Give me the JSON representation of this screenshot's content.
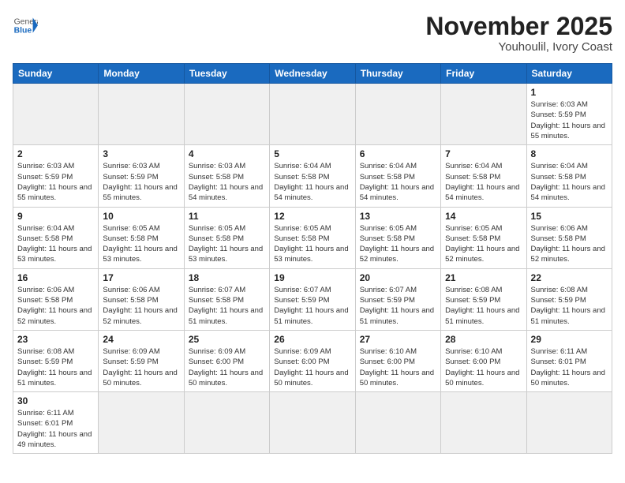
{
  "header": {
    "logo_general": "General",
    "logo_blue": "Blue",
    "month_title": "November 2025",
    "subtitle": "Youhoulil, Ivory Coast"
  },
  "days_of_week": [
    "Sunday",
    "Monday",
    "Tuesday",
    "Wednesday",
    "Thursday",
    "Friday",
    "Saturday"
  ],
  "weeks": [
    [
      {
        "day": null
      },
      {
        "day": null
      },
      {
        "day": null
      },
      {
        "day": null
      },
      {
        "day": null
      },
      {
        "day": null
      },
      {
        "day": "1",
        "sunrise": "6:03 AM",
        "sunset": "5:59 PM",
        "daylight": "11 hours and 55 minutes."
      }
    ],
    [
      {
        "day": "2",
        "sunrise": "6:03 AM",
        "sunset": "5:59 PM",
        "daylight": "11 hours and 55 minutes."
      },
      {
        "day": "3",
        "sunrise": "6:03 AM",
        "sunset": "5:59 PM",
        "daylight": "11 hours and 55 minutes."
      },
      {
        "day": "4",
        "sunrise": "6:03 AM",
        "sunset": "5:58 PM",
        "daylight": "11 hours and 54 minutes."
      },
      {
        "day": "5",
        "sunrise": "6:04 AM",
        "sunset": "5:58 PM",
        "daylight": "11 hours and 54 minutes."
      },
      {
        "day": "6",
        "sunrise": "6:04 AM",
        "sunset": "5:58 PM",
        "daylight": "11 hours and 54 minutes."
      },
      {
        "day": "7",
        "sunrise": "6:04 AM",
        "sunset": "5:58 PM",
        "daylight": "11 hours and 54 minutes."
      },
      {
        "day": "8",
        "sunrise": "6:04 AM",
        "sunset": "5:58 PM",
        "daylight": "11 hours and 54 minutes."
      }
    ],
    [
      {
        "day": "9",
        "sunrise": "6:04 AM",
        "sunset": "5:58 PM",
        "daylight": "11 hours and 53 minutes."
      },
      {
        "day": "10",
        "sunrise": "6:05 AM",
        "sunset": "5:58 PM",
        "daylight": "11 hours and 53 minutes."
      },
      {
        "day": "11",
        "sunrise": "6:05 AM",
        "sunset": "5:58 PM",
        "daylight": "11 hours and 53 minutes."
      },
      {
        "day": "12",
        "sunrise": "6:05 AM",
        "sunset": "5:58 PM",
        "daylight": "11 hours and 53 minutes."
      },
      {
        "day": "13",
        "sunrise": "6:05 AM",
        "sunset": "5:58 PM",
        "daylight": "11 hours and 52 minutes."
      },
      {
        "day": "14",
        "sunrise": "6:05 AM",
        "sunset": "5:58 PM",
        "daylight": "11 hours and 52 minutes."
      },
      {
        "day": "15",
        "sunrise": "6:06 AM",
        "sunset": "5:58 PM",
        "daylight": "11 hours and 52 minutes."
      }
    ],
    [
      {
        "day": "16",
        "sunrise": "6:06 AM",
        "sunset": "5:58 PM",
        "daylight": "11 hours and 52 minutes."
      },
      {
        "day": "17",
        "sunrise": "6:06 AM",
        "sunset": "5:58 PM",
        "daylight": "11 hours and 52 minutes."
      },
      {
        "day": "18",
        "sunrise": "6:07 AM",
        "sunset": "5:58 PM",
        "daylight": "11 hours and 51 minutes."
      },
      {
        "day": "19",
        "sunrise": "6:07 AM",
        "sunset": "5:59 PM",
        "daylight": "11 hours and 51 minutes."
      },
      {
        "day": "20",
        "sunrise": "6:07 AM",
        "sunset": "5:59 PM",
        "daylight": "11 hours and 51 minutes."
      },
      {
        "day": "21",
        "sunrise": "6:08 AM",
        "sunset": "5:59 PM",
        "daylight": "11 hours and 51 minutes."
      },
      {
        "day": "22",
        "sunrise": "6:08 AM",
        "sunset": "5:59 PM",
        "daylight": "11 hours and 51 minutes."
      }
    ],
    [
      {
        "day": "23",
        "sunrise": "6:08 AM",
        "sunset": "5:59 PM",
        "daylight": "11 hours and 51 minutes."
      },
      {
        "day": "24",
        "sunrise": "6:09 AM",
        "sunset": "5:59 PM",
        "daylight": "11 hours and 50 minutes."
      },
      {
        "day": "25",
        "sunrise": "6:09 AM",
        "sunset": "6:00 PM",
        "daylight": "11 hours and 50 minutes."
      },
      {
        "day": "26",
        "sunrise": "6:09 AM",
        "sunset": "6:00 PM",
        "daylight": "11 hours and 50 minutes."
      },
      {
        "day": "27",
        "sunrise": "6:10 AM",
        "sunset": "6:00 PM",
        "daylight": "11 hours and 50 minutes."
      },
      {
        "day": "28",
        "sunrise": "6:10 AM",
        "sunset": "6:00 PM",
        "daylight": "11 hours and 50 minutes."
      },
      {
        "day": "29",
        "sunrise": "6:11 AM",
        "sunset": "6:01 PM",
        "daylight": "11 hours and 50 minutes."
      }
    ],
    [
      {
        "day": "30",
        "sunrise": "6:11 AM",
        "sunset": "6:01 PM",
        "daylight": "11 hours and 49 minutes."
      },
      {
        "day": null
      },
      {
        "day": null
      },
      {
        "day": null
      },
      {
        "day": null
      },
      {
        "day": null
      },
      {
        "day": null
      }
    ]
  ]
}
